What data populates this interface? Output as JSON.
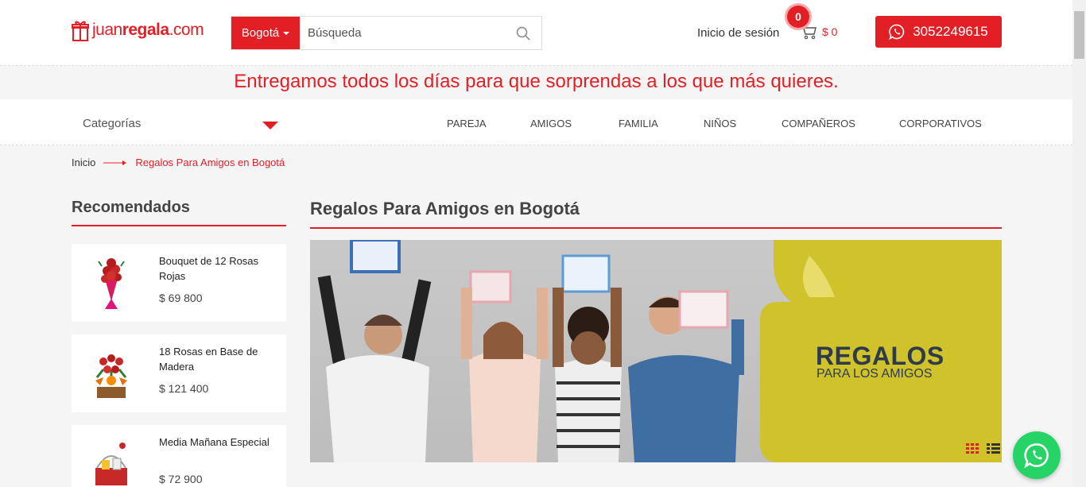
{
  "header": {
    "logo": {
      "part1": "juan",
      "part2": "regala",
      "part3": ".com"
    },
    "city_label": "Bogotá",
    "search_placeholder": "Búsqueda",
    "login_label": "Inicio de sesión",
    "cart_count": "0",
    "cart_total": "$ 0",
    "whatsapp_number": "3052249615"
  },
  "announcement": "Entregamos todos los días para que sorprendas a los que más quieres.",
  "nav": {
    "categories_label": "Categorías",
    "items": [
      "PAREJA",
      "AMIGOS",
      "FAMILIA",
      "NIÑOS",
      "COMPAÑEROS",
      "CORPORATIVOS"
    ]
  },
  "breadcrumb": {
    "home": "Inicio",
    "current": "Regalos Para Amigos en Bogotá"
  },
  "sidebar": {
    "title": "Recomendados",
    "products": [
      {
        "name": "Bouquet de 12 Rosas Rojas",
        "price": "$ 69 800"
      },
      {
        "name": "18 Rosas en Base de Madera",
        "price": "$ 121 400"
      },
      {
        "name": "Media Mañana Especial",
        "price": "$ 72 900"
      }
    ]
  },
  "main": {
    "title": "Regalos Para Amigos en Bogotá",
    "banner_heading": "REGALOS",
    "banner_sub": "PARA LOS AMIGOS"
  },
  "colors": {
    "brand_red": "#e31f26",
    "whatsapp_green": "#25d366",
    "banner_yellow": "#cfc22a"
  },
  "icons": [
    "gift-logo-icon",
    "search-icon",
    "cart-icon",
    "whatsapp-icon",
    "grid-view-icon",
    "list-view-icon"
  ]
}
